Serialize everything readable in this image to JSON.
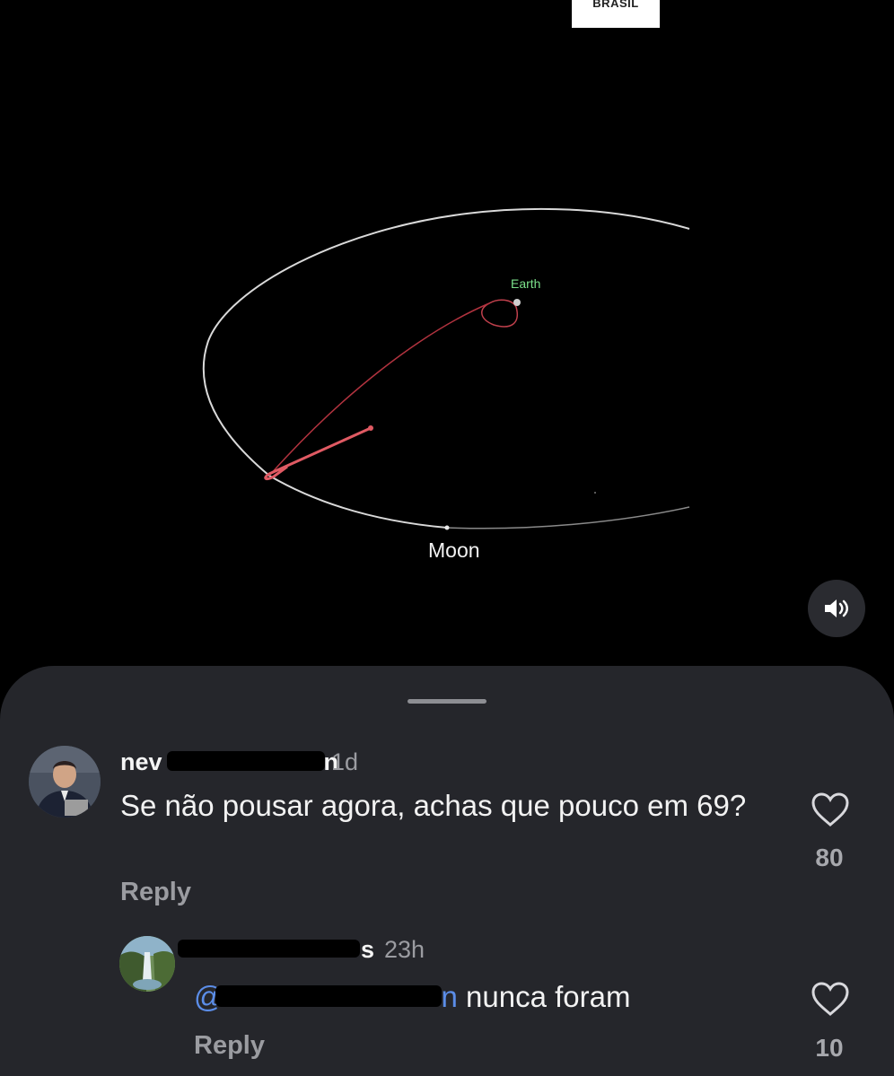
{
  "video": {
    "logo_text": "BRASIL",
    "earth_label": "Earth",
    "moon_label": "Moon",
    "sound_icon": "speaker-volume-icon",
    "colors": {
      "orbit": "#d9d9d9",
      "trajectory": "#d9535c",
      "earth_label": "#7be08a"
    }
  },
  "sheet": {
    "comments": [
      {
        "username_prefix": "nev",
        "username_suffix": "n",
        "time": "1d",
        "text": "Se não pousar agora, achas que pouco em 69?",
        "reply_label": "Reply",
        "likes": "80"
      },
      {
        "username_suffix": "s",
        "time": "23h",
        "mention_prefix": "@",
        "mention_suffix": "n",
        "text": " nunca foram",
        "reply_label": "Reply",
        "likes": "10"
      }
    ]
  }
}
